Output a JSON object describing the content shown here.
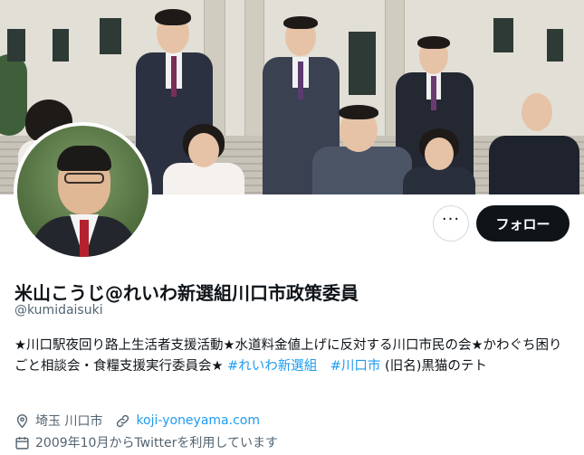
{
  "profile": {
    "display_name": "米山こうじ@れいわ新選組川口市政策委員",
    "handle": "@kumidaisuki",
    "bio_text": "★川口駅夜回り路上生活者支援活動★水道料金値上げに反対する川口市民の会★かわぐち困りごと相談会・食糧支援実行委員会★ ",
    "bio_hashtag_1": "#れいわ新選組",
    "bio_hashtag_2": "#川口市",
    "bio_tail": " (旧名)黒猫のテト",
    "location": "埼玉 川口市",
    "website": "koji-yoneyama.com",
    "joined": "2009年10月からTwitterを利用しています"
  },
  "actions": {
    "more_label": "···",
    "follow_label": "フォロー"
  },
  "icons": {
    "location": "location-pin-icon",
    "link": "link-icon",
    "calendar": "calendar-icon",
    "more": "more-horizontal-icon"
  },
  "colors": {
    "accent": "#1d9bf0",
    "follow_button_bg": "#0f1419",
    "secondary_text": "#536471"
  }
}
